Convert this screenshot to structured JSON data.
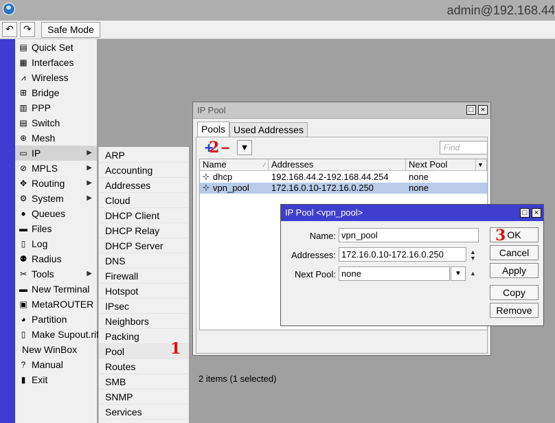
{
  "window": {
    "connection_title": "admin@192.168.44"
  },
  "toolbar": {
    "undo_icon": "undo-icon",
    "redo_icon": "redo-icon",
    "safe_mode_label": "Safe Mode"
  },
  "menu": {
    "items": [
      {
        "label": "Quick Set",
        "icon": "quick-set-icon",
        "glyph": "▤"
      },
      {
        "label": "Interfaces",
        "icon": "interfaces-icon",
        "glyph": "▦"
      },
      {
        "label": "Wireless",
        "icon": "wireless-icon",
        "glyph": "⩘"
      },
      {
        "label": "Bridge",
        "icon": "bridge-icon",
        "glyph": "⊞"
      },
      {
        "label": "PPP",
        "icon": "ppp-icon",
        "glyph": "▥"
      },
      {
        "label": "Switch",
        "icon": "switch-icon",
        "glyph": "▤"
      },
      {
        "label": "Mesh",
        "icon": "mesh-icon",
        "glyph": "⊕"
      },
      {
        "label": "IP",
        "icon": "ip-icon",
        "glyph": "▭",
        "submenu": true
      },
      {
        "label": "MPLS",
        "icon": "mpls-icon",
        "glyph": "⊘",
        "submenu": true
      },
      {
        "label": "Routing",
        "icon": "routing-icon",
        "glyph": "✥",
        "submenu": true
      },
      {
        "label": "System",
        "icon": "system-icon",
        "glyph": "⚙",
        "submenu": true
      },
      {
        "label": "Queues",
        "icon": "queues-icon",
        "glyph": "●"
      },
      {
        "label": "Files",
        "icon": "files-icon",
        "glyph": "▬"
      },
      {
        "label": "Log",
        "icon": "log-icon",
        "glyph": "▯"
      },
      {
        "label": "Radius",
        "icon": "radius-icon",
        "glyph": "⚉"
      },
      {
        "label": "Tools",
        "icon": "tools-icon",
        "glyph": "✂",
        "submenu": true
      },
      {
        "label": "New Terminal",
        "icon": "terminal-icon",
        "glyph": "▬"
      },
      {
        "label": "MetaROUTER",
        "icon": "metarouter-icon",
        "glyph": "▣"
      },
      {
        "label": "Partition",
        "icon": "partition-icon",
        "glyph": "◕"
      },
      {
        "label": "Make Supout.rif",
        "icon": "supout-icon",
        "glyph": "▯"
      },
      {
        "label": "New WinBox",
        "icon": "",
        "glyph": ""
      },
      {
        "label": "Manual",
        "icon": "manual-icon",
        "glyph": "?"
      },
      {
        "label": "Exit",
        "icon": "exit-icon",
        "glyph": "▮"
      }
    ],
    "arrow_glyph": "▶"
  },
  "submenu": {
    "items": [
      "ARP",
      "Accounting",
      "Addresses",
      "Cloud",
      "DHCP Client",
      "DHCP Relay",
      "DHCP Server",
      "DNS",
      "Firewall",
      "Hotspot",
      "IPsec",
      "Neighbors",
      "Packing",
      "Pool",
      "Routes",
      "SMB",
      "SNMP",
      "Services"
    ]
  },
  "annotations": {
    "step1": "1",
    "step2": "2",
    "step3": "3"
  },
  "ip_pool": {
    "title": "IP Pool",
    "tabs": [
      "Pools",
      "Used Addresses"
    ],
    "plus_glyph": "+",
    "minus_glyph": "−",
    "filter_glyph": "▼",
    "find_placeholder": "Find",
    "columns": [
      "Name",
      "Addresses",
      "Next Pool"
    ],
    "rows": [
      {
        "name": "dhcp",
        "addresses": "192.168.44.2-192.168.44.254",
        "next_pool": "none"
      },
      {
        "name": "vpn_pool",
        "addresses": "172.16.0.10-172.16.0.250",
        "next_pool": "none"
      }
    ],
    "status": "2 items (1 selected)"
  },
  "dialog": {
    "title": "IP Pool <vpn_pool>",
    "name_label": "Name:",
    "name_value": "vpn_pool",
    "addresses_label": "Addresses:",
    "addresses_value": "172.16.0.10-172.16.0.250",
    "next_pool_label": "Next Pool:",
    "next_pool_value": "none",
    "buttons": {
      "ok": "OK",
      "cancel": "Cancel",
      "apply": "Apply",
      "copy": "Copy",
      "remove": "Remove"
    }
  },
  "colors": {
    "sidebar_bar": "#3c3cd0",
    "dialog_title": "#3f3fcf",
    "selected_row": "#b8cbe8",
    "annotation": "#e01010"
  }
}
